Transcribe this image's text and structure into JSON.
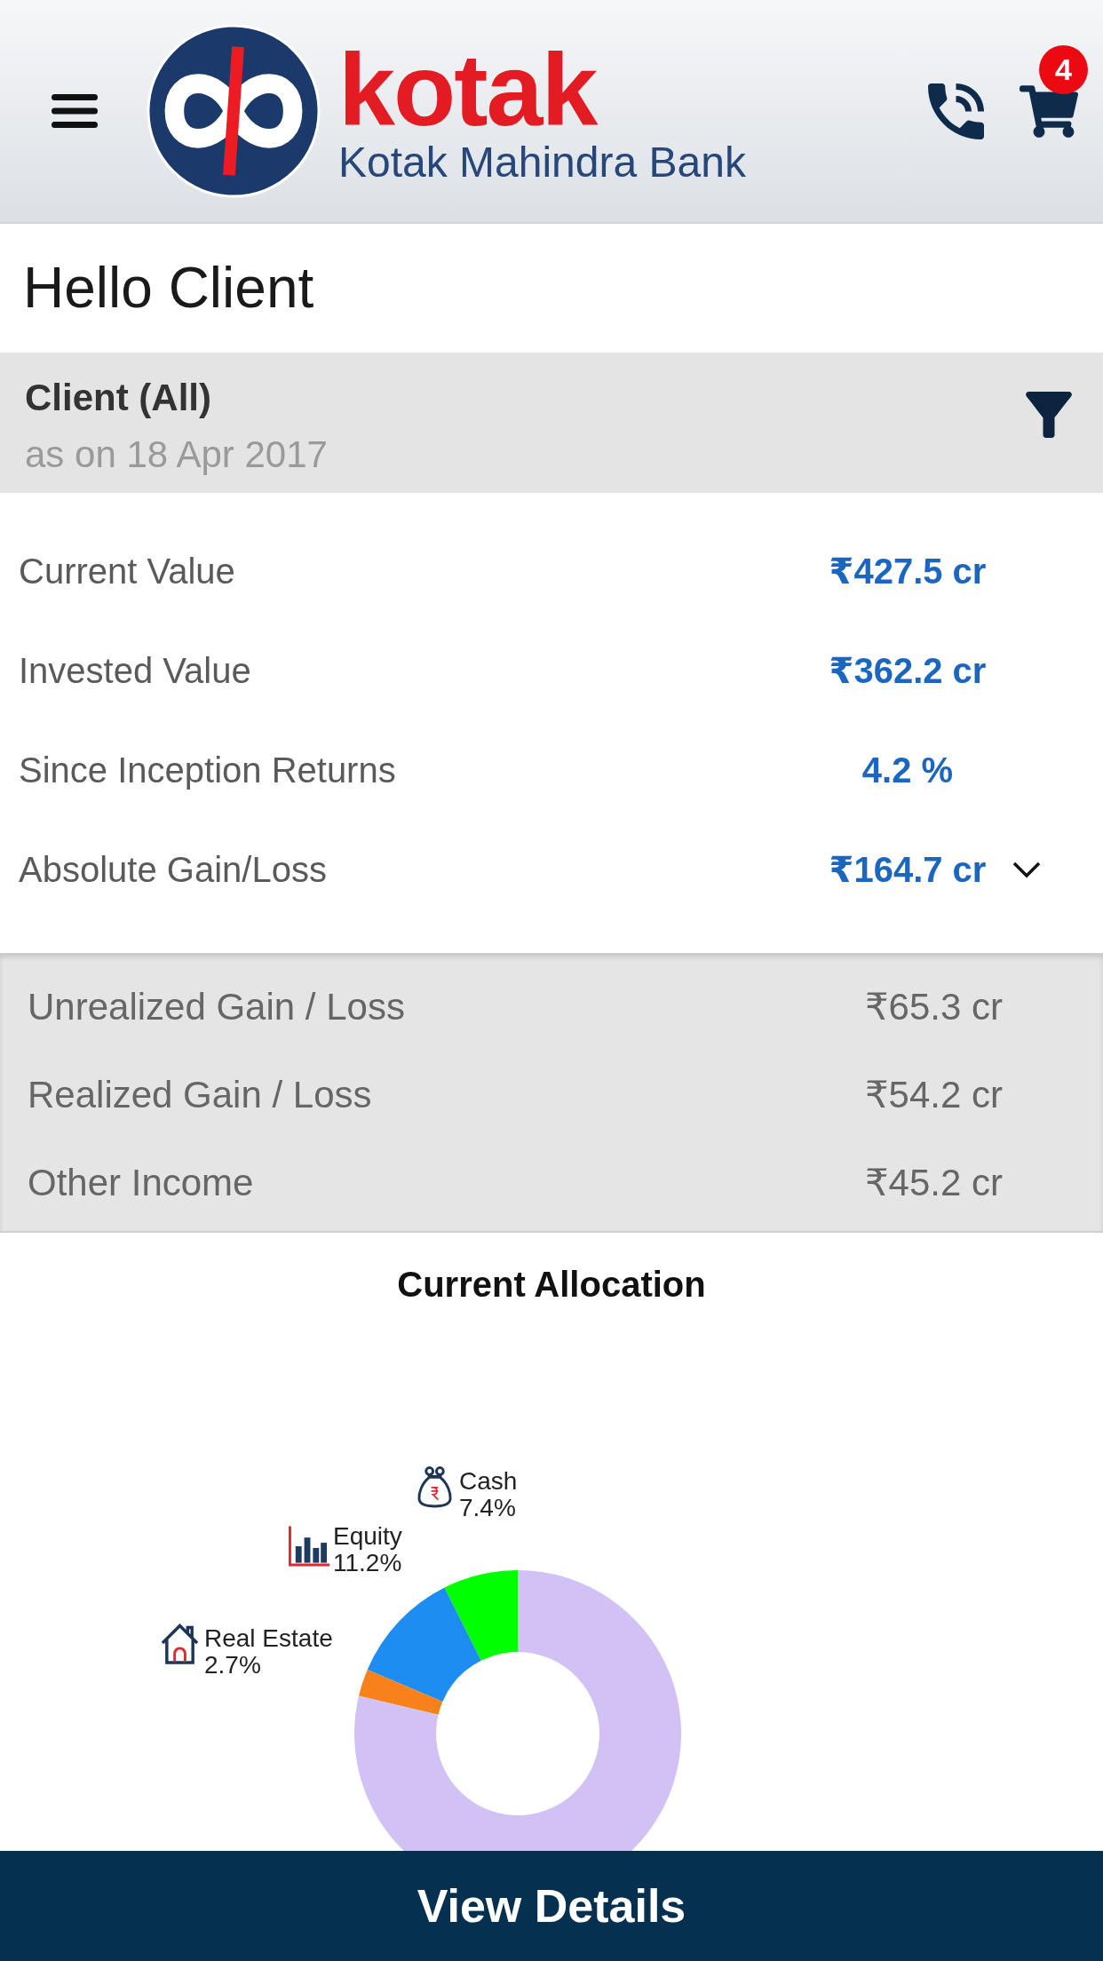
{
  "header": {
    "brand_name": "kotak",
    "brand_subtitle": "Kotak Mahindra Bank",
    "cart_count": "4"
  },
  "greeting": "Hello Client",
  "client_filter": {
    "title": "Client (All)",
    "as_of": "as on 18 Apr 2017"
  },
  "summary": [
    {
      "label": "Current Value",
      "value": "₹427.5 cr"
    },
    {
      "label": "Invested Value",
      "value": "₹362.2 cr"
    },
    {
      "label": "Since Inception Returns",
      "value": "4.2 %"
    }
  ],
  "gain_loss": {
    "label": "Absolute Gain/Loss",
    "value": "₹164.7 cr",
    "expanded": true,
    "breakdown": [
      {
        "label": "Unrealized Gain / Loss",
        "value": "₹65.3 cr"
      },
      {
        "label": "Realized Gain / Loss",
        "value": "₹54.2 cr"
      },
      {
        "label": "Other Income",
        "value": "₹45.2 cr"
      }
    ]
  },
  "allocation": {
    "chart_data": {
      "type": "donut",
      "title": "Current Allocation",
      "categories": [
        "Cash",
        "Equity",
        "Real Estate",
        null
      ],
      "values": [
        7.4,
        11.2,
        2.7,
        78.7
      ],
      "value_labels": [
        "7.4%",
        "11.2%",
        "2.7%",
        null
      ],
      "colors": [
        "#00ff00",
        "#1e8df2",
        "#f7821b",
        "#d2c1f5"
      ]
    }
  },
  "footer_button": {
    "label": "View Details"
  }
}
